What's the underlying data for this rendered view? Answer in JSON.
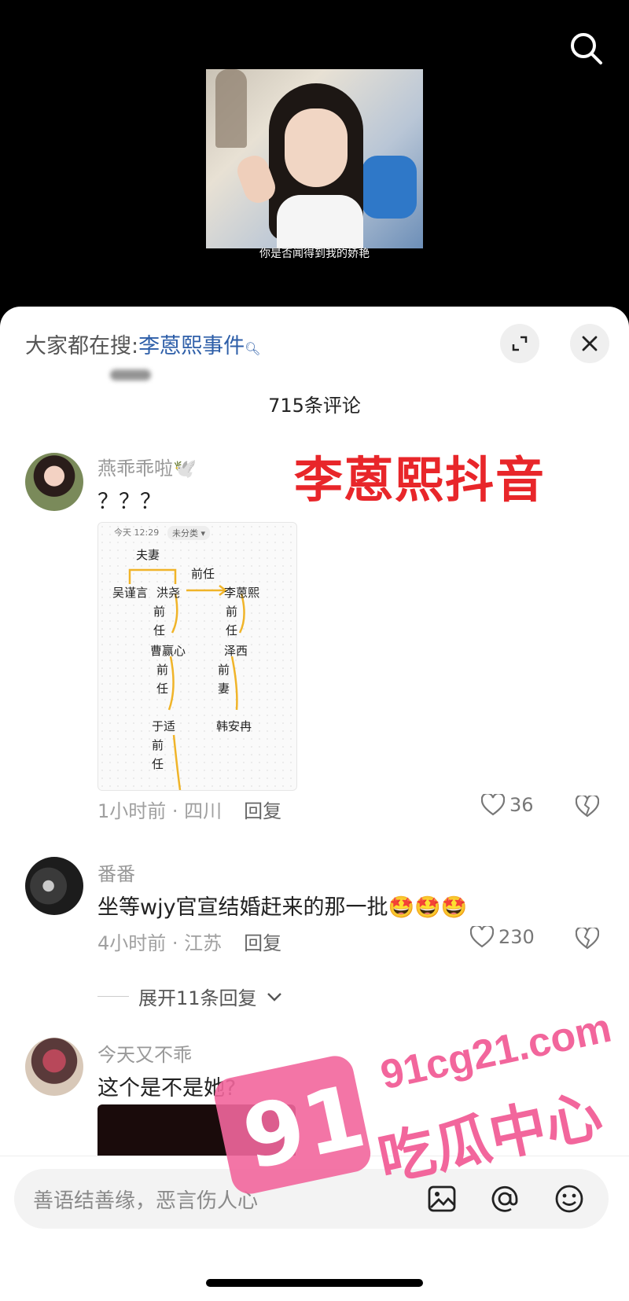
{
  "video": {
    "caption": "你是否闻得到我的娇艳"
  },
  "sheet": {
    "hot_search_prefix": "大家都在搜:",
    "hot_search_keyword": "李蒽熙事件",
    "comment_count": "715条评论"
  },
  "overlay_text": "李蒽熙抖音",
  "comments": [
    {
      "user": "燕乖乖啦🕊️",
      "text": "？？？",
      "time_location": "1小时前 · 四川",
      "reply_label": "回复",
      "likes": "36",
      "note_image": {
        "header": "今天 12:29",
        "tag": "未分类 ▾",
        "lines": [
          "夫妻",
          "前任",
          "吴谨言",
          "洪尧",
          "李蒽熙",
          "前",
          "任",
          "前",
          "任",
          "曹赢心",
          "泽西",
          "前",
          "任",
          "前",
          "妻",
          "于适",
          "韩安冉",
          "前",
          "任"
        ]
      }
    },
    {
      "user": "番番",
      "text": "坐等wjy官宣结婚赶来的那一批🤩🤩🤩",
      "time_location": "4小时前 · 江苏",
      "reply_label": "回复",
      "likes": "230",
      "expand_label": "展开11条回复"
    },
    {
      "user": "今天又不乖",
      "text": "这个是不是她?"
    }
  ],
  "input": {
    "placeholder": "善语结善缘，恶言伤人心"
  },
  "watermark": {
    "badge": "91",
    "url": "91cg21.com",
    "name": "吃瓜中心"
  }
}
